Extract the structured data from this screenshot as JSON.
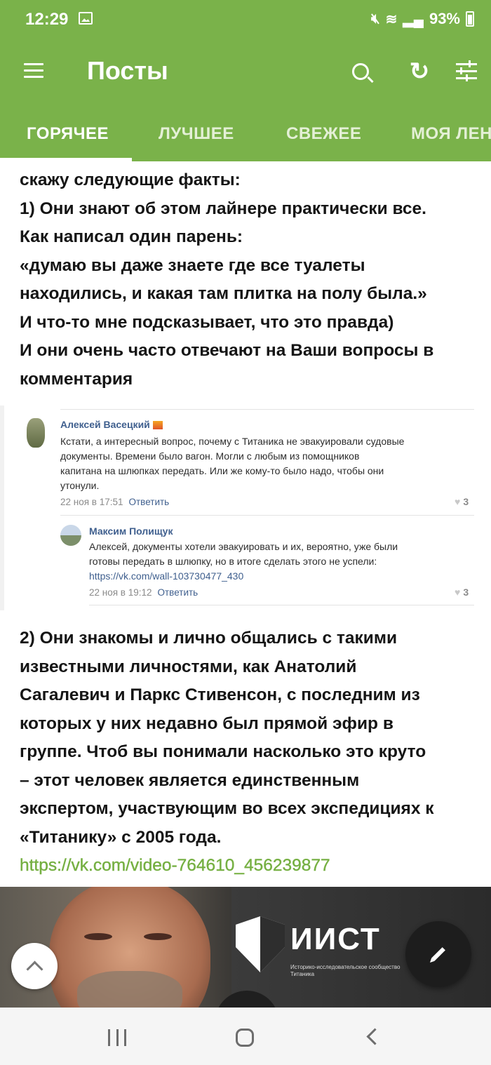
{
  "status": {
    "time": "12:29",
    "battery": "93%",
    "icons": [
      "gallery-icon",
      "mute-icon",
      "wifi-icon",
      "signal-icon",
      "battery-charging-icon"
    ]
  },
  "header": {
    "title": "Посты",
    "icons": [
      "menu-icon",
      "search-icon",
      "refresh-icon",
      "filter-icon"
    ]
  },
  "tabs": [
    {
      "label": "ГОРЯЧЕЕ",
      "active": true
    },
    {
      "label": "ЛУЧШЕЕ",
      "active": false
    },
    {
      "label": "СВЕЖЕЕ",
      "active": false
    },
    {
      "label": "МОЯ ЛЕН",
      "active": false
    }
  ],
  "post": {
    "para1": [
      "скажу следующие факты:",
      "1) Они знают об этом лайнере практически все.",
      "Как написал один парень:",
      "«думаю вы даже знаете где все туалеты",
      "находились, и какая там плитка на полу была.»",
      "И что-то мне подсказывает, что это правда)",
      "И они очень часто отвечают на Ваши вопросы в",
      "комментария"
    ],
    "para2": [
      "2) Они знакомы и лично общались с такими",
      "известными личностями, как Анатолий",
      "Сагалевич и Паркс Стивенсон, с последним из",
      "которых у них недавно был прямой эфир в",
      "группе. Чтоб вы понимали насколько это круто",
      "– этот человек является единственным",
      "экспертом, участвующим во всех экспедициях к",
      "«Титанику» с 2005 года."
    ],
    "link": "https://vk.com/video-764610_456239877"
  },
  "comments": [
    {
      "author": "Алексей Васецкий",
      "text": [
        "Кстати, а интересный вопрос, почему с Титаника не эвакуировали судовые",
        "документы. Времени было вагон. Могли с любым из помощников",
        "капитана на шлюпках передать. Или же кому-то было надо, чтобы они",
        "утонули."
      ],
      "date": "22 ноя в 17:51",
      "reply": "Ответить",
      "likes": "3"
    },
    {
      "author": "Максим Полищук",
      "text": [
        "Алексей, документы хотели эвакуировать и их, вероятно, уже были",
        "готовы передать в шлюпку, но в итоге сделать этого не успели:"
      ],
      "link": "https://vk.com/wall-103730477_430",
      "date": "22 ноя в 19:12",
      "reply": "Ответить",
      "likes": "3"
    }
  ],
  "video": {
    "logo": "ИИСТ",
    "logo_sub": "Историко-исследовательское сообщество Титаника"
  },
  "fabs": [
    "scroll-up-icon",
    "edit-icon"
  ],
  "nav": [
    "recent-apps-icon",
    "home-icon",
    "back-icon"
  ],
  "colors": {
    "accent": "#7ab24a",
    "link": "#76b043",
    "vk_link": "#3f5f8e"
  }
}
